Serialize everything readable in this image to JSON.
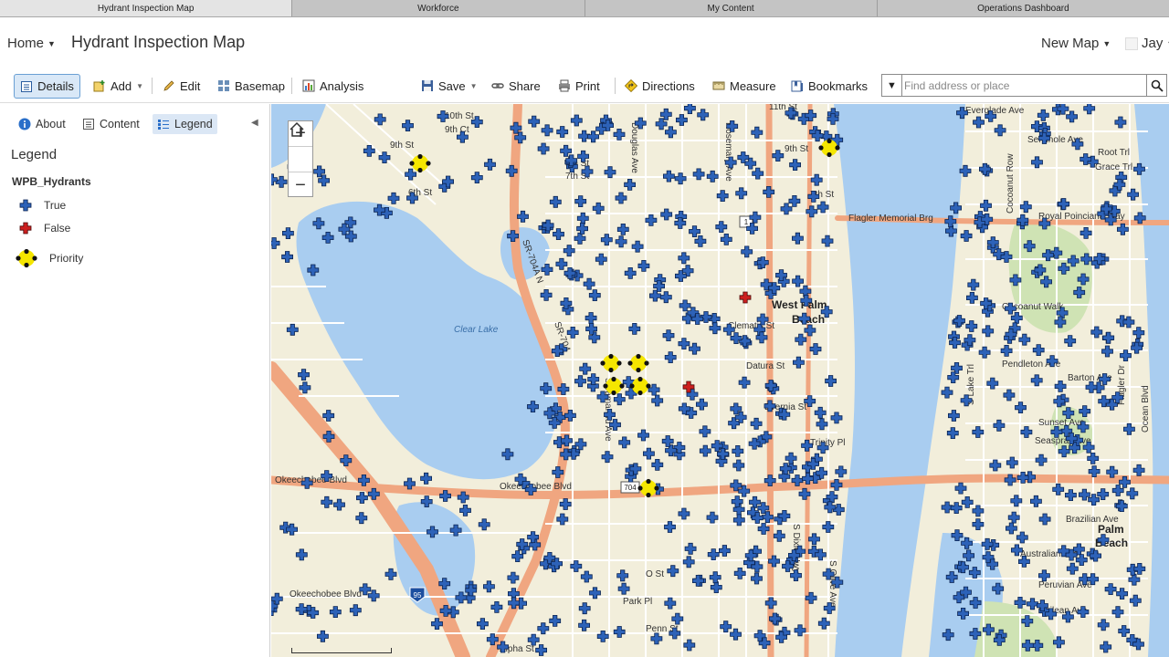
{
  "browser_tabs": [
    {
      "label": "Hydrant Inspection Map",
      "active": true
    },
    {
      "label": "Workforce",
      "active": false
    },
    {
      "label": "My Content",
      "active": false
    },
    {
      "label": "Operations Dashboard",
      "active": false
    }
  ],
  "header": {
    "home_label": "Home",
    "map_title": "Hydrant Inspection Map",
    "new_map_label": "New Map",
    "user_label": "Jay"
  },
  "toolbar": {
    "details": "Details",
    "add": "Add",
    "edit": "Edit",
    "basemap": "Basemap",
    "analysis": "Analysis",
    "save": "Save",
    "share": "Share",
    "print": "Print",
    "directions": "Directions",
    "measure": "Measure",
    "bookmarks": "Bookmarks",
    "search_placeholder": "Find address or place"
  },
  "panel": {
    "tabs": {
      "about": "About",
      "content": "Content",
      "legend": "Legend"
    },
    "heading": "Legend",
    "layer": "WPB_Hydrants",
    "items": {
      "true": "True",
      "false": "False",
      "priority": "Priority"
    }
  },
  "map": {
    "labels": {
      "st6": "6th St",
      "st7": "7th St",
      "st8": "8th St",
      "st9": "9th St",
      "ct9": "9th Ct",
      "st10": "10th St",
      "st7e": "7th St",
      "st9e": "9th St",
      "st11": "11th St",
      "clear_lake": "Clear Lake",
      "okeechobee_blvd": "Okeechobee Blvd",
      "okeechobee_w": "Okeechobee Blvd",
      "okee_sw": "Okeechobee Blvd",
      "flagler_brg": "Flagler Memorial Brg",
      "west_palm": "West Palm",
      "beach": "Beach",
      "royal_poinciana": "Royal Poinciana Way",
      "seminole": "Seminole Ave",
      "everglade": "Everglade Ave",
      "root_trl": "Root Trl",
      "grace_trl": "Grace Trl",
      "cocoanut": "Cocoanut Walk",
      "pendleton": "Pendleton Ave",
      "barton": "Barton Ave",
      "sunset": "Sunset Ave",
      "seaspray": "Seaspray Ave",
      "brazilian": "Brazilian Ave",
      "australian": "Australian Ave",
      "peruvian": "Peruvian Ave",
      "chilean": "Chilean Ave",
      "palm": "Palm",
      "beach2": "Beach",
      "clematis": "Clematis St",
      "datura": "Datura St",
      "evernia": "Evernia St",
      "trinity": "Trinity Pl",
      "alpha": "Alpha St",
      "penn": "Penn St",
      "ostr": "O St",
      "park": "Park Pl",
      "sr704a": "SR-704A N",
      "sr704": "SR-704",
      "douglas": "Douglas Ave",
      "tamarind": "S Tamarind Ave",
      "rosemary": "Rosemary Ave",
      "dixie": "S Dixie Hwy",
      "olive": "S Olive Ave",
      "cocoanut_row": "Cocoanut Row",
      "lake_trl": "S Lake Trl",
      "flagler_dr": "Flagler Dr",
      "ocean_blvd": "Ocean Blvd",
      "shield_1": "1",
      "shield_95": "95",
      "shield_704": "704"
    }
  },
  "colors": {
    "hydrant_true": "#2d62b8",
    "hydrant_false": "#cc1f1f",
    "priority": "#f5e600",
    "water": "#a9cdf0",
    "land": "#f2eedb",
    "highway": "#f0a680",
    "accent": "#6aa0d4"
  }
}
